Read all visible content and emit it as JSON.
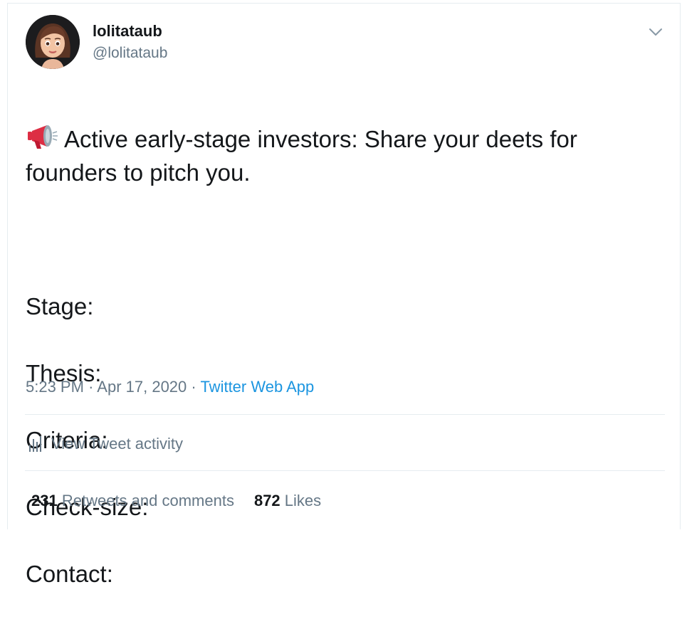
{
  "author": {
    "display_name": "lolitataub",
    "handle": "@lolitataub"
  },
  "tweet": {
    "emoji_icon": "megaphone-icon",
    "first_line": "Active early-stage investors: Share your deets for founders to pitch you.",
    "fields": [
      "Stage:",
      "Thesis:",
      "Criteria:",
      "Check-size:",
      "Contact:"
    ]
  },
  "meta": {
    "time": "5:23 PM",
    "dot1": "·",
    "date": "Apr 17, 2020",
    "dot2": "·",
    "source": "Twitter Web App"
  },
  "activity": {
    "icon": "bar-chart-icon",
    "label": "View Tweet activity"
  },
  "stats": {
    "retweets_count": "231",
    "retweets_label": "Retweets and comments",
    "likes_count": "872",
    "likes_label": "Likes"
  },
  "colors": {
    "text": "#14171a",
    "secondary": "#657786",
    "link": "#1b95e0",
    "divider": "#e6ecf0",
    "megaphone": "#dd2e44"
  }
}
